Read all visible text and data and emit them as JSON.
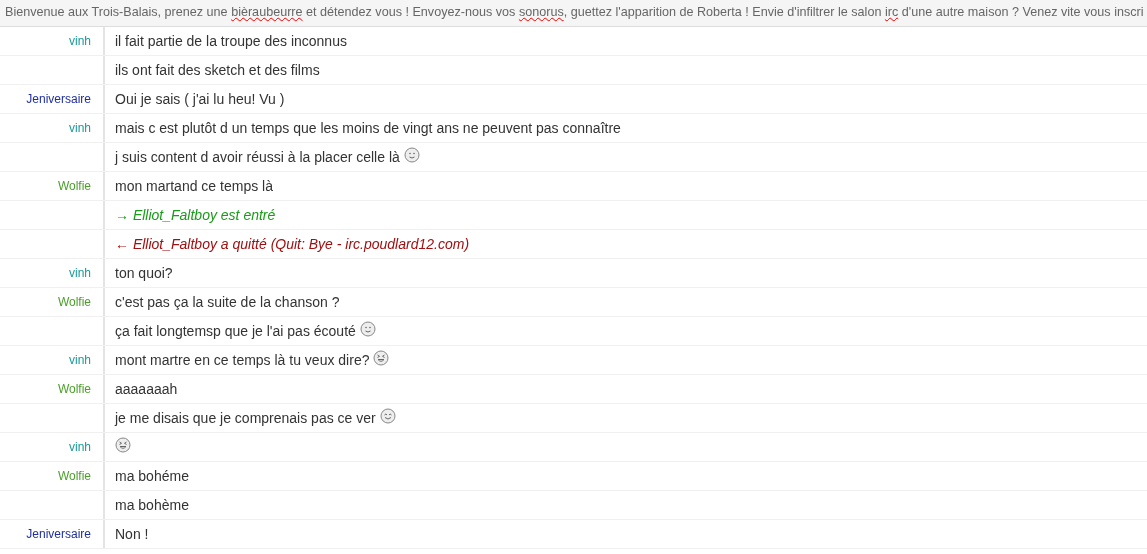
{
  "topic": [
    {
      "text": "Bienvenue aux Trois-Balais, prenez une ",
      "misspelled": false
    },
    {
      "text": "bièraubeurre",
      "misspelled": true
    },
    {
      "text": " et détendez vous ! Envoyez-nous vos ",
      "misspelled": false
    },
    {
      "text": "sonorus",
      "misspelled": true
    },
    {
      "text": ", guettez l'apparition de Roberta ! Envie d'infiltrer le salon ",
      "misspelled": false
    },
    {
      "text": "irc",
      "misspelled": true
    },
    {
      "text": " d'une autre maison ? Venez vite vous inscri",
      "misspelled": false
    }
  ],
  "messages": [
    {
      "kind": "message",
      "nick": "vinh",
      "color": "#1a9a9a",
      "text": "il fait partie de la troupe des inconnus"
    },
    {
      "kind": "message",
      "text": "ils ont fait des sketch et des films"
    },
    {
      "kind": "message",
      "nick": "Jeniversaire",
      "color": "#1f2f9f",
      "text": "Oui je sais ( j'ai lu heu! Vu )"
    },
    {
      "kind": "message",
      "nick": "vinh",
      "color": "#1a9a9a",
      "text": "mais c est plutôt d un temps que les moins de vingt ans ne peuvent pas connaître"
    },
    {
      "kind": "message",
      "text": "j suis content d avoir réussi à la placer celle là",
      "emoticon": {
        "kind": "smile"
      }
    },
    {
      "kind": "message",
      "nick": "Wolfie",
      "color": "#4a9f2a",
      "text": "mon martand ce temps là"
    },
    {
      "kind": "join",
      "text": "→ Elliot_Faltboy est entré"
    },
    {
      "kind": "part",
      "text": "← Elliot_Faltboy a quitté (Quit: Bye - irc.poudlard12.com)"
    },
    {
      "kind": "message",
      "nick": "vinh",
      "color": "#1a9a9a",
      "text": "ton quoi?"
    },
    {
      "kind": "message",
      "nick": "Wolfie",
      "color": "#4a9f2a",
      "text": "c'est pas ça la suite de la chanson ?"
    },
    {
      "kind": "message",
      "text": "ça fait longtemsp que je l'ai pas écouté",
      "emoticon": {
        "kind": "smile"
      }
    },
    {
      "kind": "message",
      "nick": "vinh",
      "color": "#1a9a9a",
      "text": "mont martre en ce temps là tu veux dire?",
      "emoticon": {
        "kind": "laugh"
      }
    },
    {
      "kind": "message",
      "nick": "Wolfie",
      "color": "#4a9f2a",
      "text": "aaaaaaah"
    },
    {
      "kind": "message",
      "text": "je me disais que je comprenais pas ce ver",
      "emoticon": {
        "kind": "happy"
      }
    },
    {
      "kind": "message",
      "nick": "vinh",
      "color": "#1a9a9a",
      "emoticon": {
        "kind": "laugh"
      }
    },
    {
      "kind": "message",
      "nick": "Wolfie",
      "color": "#4a9f2a",
      "text": "ma bohéme"
    },
    {
      "kind": "message",
      "text": "ma bohème"
    },
    {
      "kind": "message",
      "nick": "Jeniversaire",
      "color": "#1f2f9f",
      "text": "Non !"
    }
  ]
}
